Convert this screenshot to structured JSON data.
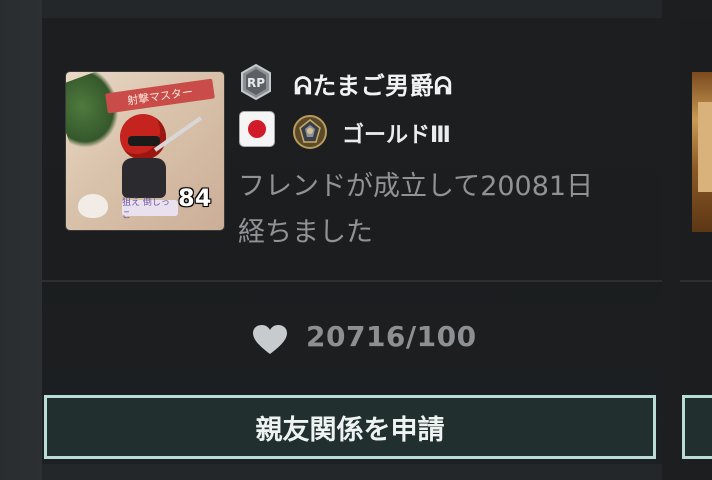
{
  "profile_card": {
    "avatar": {
      "banner_text": "射撃マスター",
      "sign_text": "狙え 倒しっこ",
      "level": "84"
    },
    "rp_badge_text": "RP",
    "player_name": "ᕱたまご男爵ᕱ",
    "region_flag": "japan-flag-icon",
    "rank": {
      "icon": "gold-rank-emblem-icon",
      "name": "ゴールドⅢ"
    },
    "friend_message": "フレンドが成立して20081日経ちました",
    "affinity": {
      "icon": "heart-icon",
      "value": "20716/100"
    },
    "request_button_label": "親友関係を申請"
  },
  "colors": {
    "card_bg": "#1c1e20",
    "button_border": "#b9ddd6",
    "button_bg": "#21302f",
    "muted_text": "#8f9396",
    "name_text": "#f2f2f2",
    "flag_red": "#d11b2a"
  }
}
